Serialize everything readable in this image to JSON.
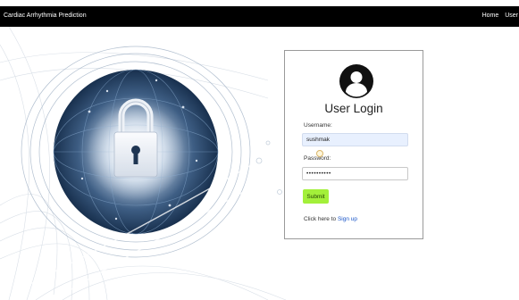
{
  "navbar": {
    "brand": "Cardiac Arrhythmia Prediction",
    "links": [
      "Home",
      "User"
    ]
  },
  "login": {
    "title": "User Login",
    "username_label": "Username:",
    "username_value": "sushmak",
    "password_label": "Password:",
    "password_value": "••••••••••",
    "submit_label": "Submit",
    "signup_prefix": "Click here to ",
    "signup_link": "Sign up"
  },
  "colors": {
    "navbar_bg": "#000000",
    "submit_bg": "#a3f03a",
    "link": "#1a56c8",
    "input_autofill": "#e8f0fe"
  },
  "icons": {
    "avatar": "user-circle-icon",
    "hero": "padlock-globe-illustration"
  }
}
